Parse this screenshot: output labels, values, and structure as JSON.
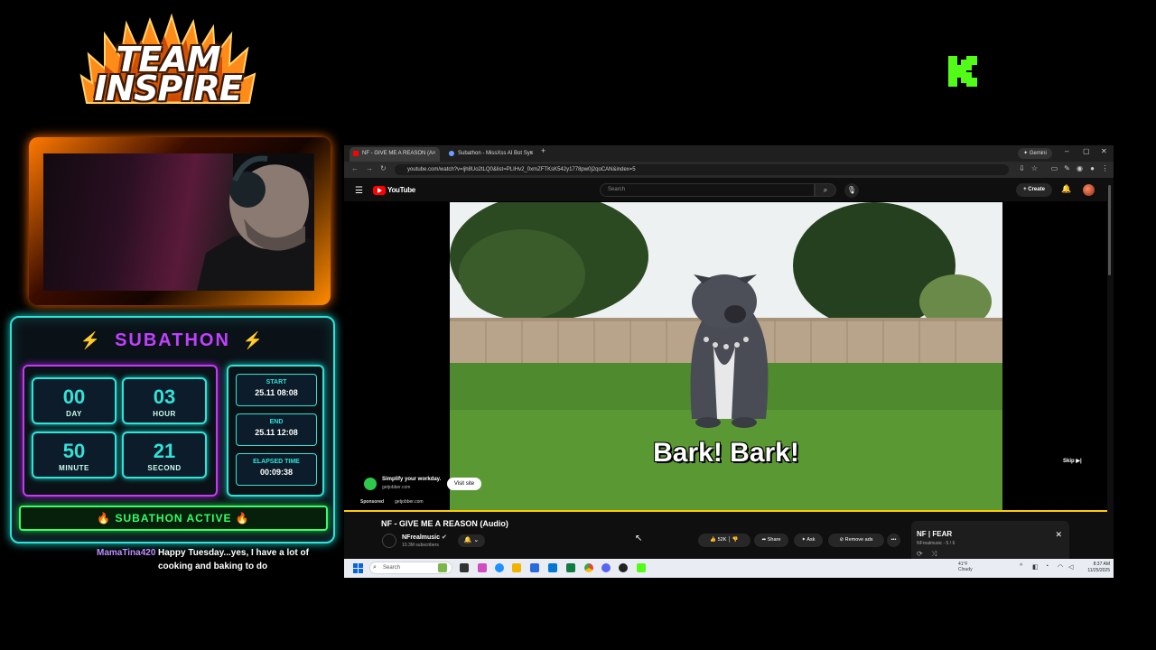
{
  "overlay": {
    "logo_line1": "TEAM",
    "logo_line2": "INSPIRE",
    "kick_icon": "kick-logo-icon"
  },
  "subathon": {
    "title": "SUBATHON",
    "timer": [
      {
        "value": "00",
        "label": "DAY"
      },
      {
        "value": "03",
        "label": "HOUR"
      },
      {
        "value": "50",
        "label": "MINUTE"
      },
      {
        "value": "21",
        "label": "SECOND"
      }
    ],
    "start_label": "START",
    "start_value": "25.11 08:08",
    "end_label": "END",
    "end_value": "25.11 12:08",
    "elapsed_label": "ELAPSED TIME",
    "elapsed_value": "00:09:38",
    "status": "🔥 SUBATHON ACTIVE 🔥",
    "colors": {
      "cyan": "#2fe3d8",
      "purple": "#c040ff",
      "green": "#33ff66"
    }
  },
  "chat": {
    "user": "MamaTina420",
    "message": "Happy Tuesday...yes, I have a lot of cooking and baking to do"
  },
  "browser": {
    "tab1_title": "NF - GIVE ME A REASON (A",
    "tab2_title": "Subathon - MissXss AI Bot Sys",
    "new_tab": "+",
    "gemini": "✦ Gemini",
    "url": "youtube.com/watch?v=ljh8Uo2tLQ0&list=PLIHv2_0xmZFTKsK542y1778pw0j2qoCAN&index=5"
  },
  "youtube": {
    "logo_text": "YouTube",
    "search_placeholder": "Search",
    "create_label": "+ Create",
    "caption": "Bark! Bark!",
    "ad_title": "Simplify your workday.",
    "ad_domain": "getjobber.com",
    "visit_label": "Visit site",
    "sponsored_label": "Sponsored",
    "sponsored_domain": "getjobber.com",
    "skip_label": "Skip ▶|",
    "progress": 1.0,
    "video_title": "NF - GIVE ME A REASON (Audio)",
    "channel_name": "NFrealmusic",
    "channel_subs": "10.3M subscribers",
    "likes": "52K",
    "share_label": "Share",
    "ask_label": "Ask",
    "remove_ads_label": "Remove ads",
    "more_label": "•••",
    "mini_title": "NF | FEAR",
    "mini_sub": "NFrealmusic - 5 / 6"
  },
  "taskbar": {
    "search_placeholder": "Search",
    "weather_temp": "41°F",
    "weather_desc": "Cloudy",
    "time": "8:37 AM",
    "date": "11/25/2025"
  }
}
